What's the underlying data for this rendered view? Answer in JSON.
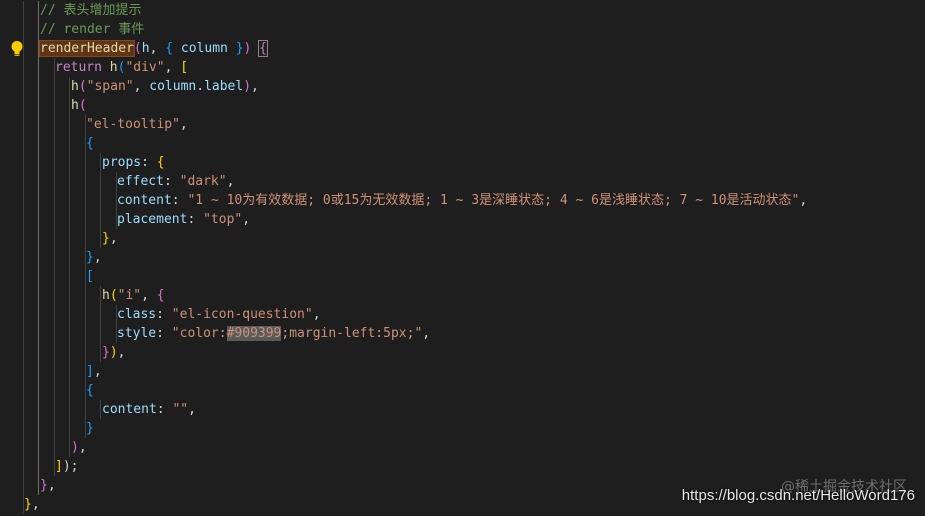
{
  "editor": {
    "lines": [
      {
        "indent": 2,
        "tokens": [
          {
            "t": "// 表头增加提示",
            "c": "c-comment"
          }
        ]
      },
      {
        "indent": 2,
        "tokens": [
          {
            "t": "// render 事件",
            "c": "c-comment"
          }
        ]
      },
      {
        "indent": 2,
        "tokens": [
          {
            "t": "renderHeader",
            "c": "c-func hl-word"
          },
          {
            "t": "(",
            "c": "c-b2"
          },
          {
            "t": "h",
            "c": "c-var"
          },
          {
            "t": ", ",
            "c": "c-punct"
          },
          {
            "t": "{",
            "c": "c-b3"
          },
          {
            "t": " ",
            "c": "c-punct"
          },
          {
            "t": "column",
            "c": "c-var"
          },
          {
            "t": " ",
            "c": "c-punct"
          },
          {
            "t": "}",
            "c": "c-b3"
          },
          {
            "t": ")",
            "c": "c-b2"
          },
          {
            "t": " ",
            "c": "c-punct"
          },
          {
            "t": "{",
            "c": "c-b2 bracket-match"
          }
        ]
      },
      {
        "indent": 3,
        "tokens": [
          {
            "t": "return",
            "c": "c-kw"
          },
          {
            "t": " ",
            "c": "c-punct"
          },
          {
            "t": "h",
            "c": "c-func"
          },
          {
            "t": "(",
            "c": "c-b3"
          },
          {
            "t": "\"div\"",
            "c": "c-str"
          },
          {
            "t": ", ",
            "c": "c-punct"
          },
          {
            "t": "[",
            "c": "c-b1"
          }
        ]
      },
      {
        "indent": 4,
        "tokens": [
          {
            "t": "h",
            "c": "c-func"
          },
          {
            "t": "(",
            "c": "c-b2"
          },
          {
            "t": "\"span\"",
            "c": "c-str"
          },
          {
            "t": ", ",
            "c": "c-punct"
          },
          {
            "t": "column",
            "c": "c-var"
          },
          {
            "t": ".",
            "c": "c-punct"
          },
          {
            "t": "label",
            "c": "c-var"
          },
          {
            "t": ")",
            "c": "c-b2"
          },
          {
            "t": ",",
            "c": "c-punct"
          }
        ]
      },
      {
        "indent": 4,
        "tokens": [
          {
            "t": "h",
            "c": "c-func"
          },
          {
            "t": "(",
            "c": "c-b2"
          }
        ]
      },
      {
        "indent": 5,
        "tokens": [
          {
            "t": "\"el-tooltip\"",
            "c": "c-str"
          },
          {
            "t": ",",
            "c": "c-punct"
          }
        ]
      },
      {
        "indent": 5,
        "tokens": [
          {
            "t": "{",
            "c": "c-b3"
          }
        ]
      },
      {
        "indent": 6,
        "tokens": [
          {
            "t": "props",
            "c": "c-prop"
          },
          {
            "t": ": ",
            "c": "c-punct"
          },
          {
            "t": "{",
            "c": "c-b1"
          }
        ]
      },
      {
        "indent": 7,
        "tokens": [
          {
            "t": "effect",
            "c": "c-prop"
          },
          {
            "t": ": ",
            "c": "c-punct"
          },
          {
            "t": "\"dark\"",
            "c": "c-str"
          },
          {
            "t": ",",
            "c": "c-punct"
          }
        ]
      },
      {
        "indent": 7,
        "tokens": [
          {
            "t": "content",
            "c": "c-prop"
          },
          {
            "t": ": ",
            "c": "c-punct"
          },
          {
            "t": "\"1 ~ 10为有效数据; 0或15为无效数据; 1 ~ 3是深睡状态; 4 ~ 6是浅睡状态; 7 ~ 10是活动状态\"",
            "c": "c-str"
          },
          {
            "t": ",",
            "c": "c-punct"
          }
        ]
      },
      {
        "indent": 7,
        "tokens": [
          {
            "t": "placement",
            "c": "c-prop"
          },
          {
            "t": ": ",
            "c": "c-punct"
          },
          {
            "t": "\"top\"",
            "c": "c-str"
          },
          {
            "t": ",",
            "c": "c-punct"
          }
        ]
      },
      {
        "indent": 6,
        "tokens": [
          {
            "t": "}",
            "c": "c-b1"
          },
          {
            "t": ",",
            "c": "c-punct"
          }
        ]
      },
      {
        "indent": 5,
        "tokens": [
          {
            "t": "}",
            "c": "c-b3"
          },
          {
            "t": ",",
            "c": "c-punct"
          }
        ]
      },
      {
        "indent": 5,
        "tokens": [
          {
            "t": "[",
            "c": "c-b3"
          }
        ]
      },
      {
        "indent": 6,
        "tokens": [
          {
            "t": "h",
            "c": "c-func"
          },
          {
            "t": "(",
            "c": "c-b1"
          },
          {
            "t": "\"i\"",
            "c": "c-str"
          },
          {
            "t": ", ",
            "c": "c-punct"
          },
          {
            "t": "{",
            "c": "c-b2"
          }
        ]
      },
      {
        "indent": 7,
        "tokens": [
          {
            "t": "class",
            "c": "c-prop"
          },
          {
            "t": ": ",
            "c": "c-punct"
          },
          {
            "t": "\"el-icon-question\"",
            "c": "c-str"
          },
          {
            "t": ",",
            "c": "c-punct"
          }
        ]
      },
      {
        "indent": 7,
        "tokens": [
          {
            "t": "style",
            "c": "c-prop"
          },
          {
            "t": ": ",
            "c": "c-punct"
          },
          {
            "t": "\"color:",
            "c": "c-str"
          },
          {
            "t": "#909399",
            "c": "c-str sel"
          },
          {
            "t": ";margin-left:5px;\"",
            "c": "c-str"
          },
          {
            "t": ",",
            "c": "c-punct"
          }
        ]
      },
      {
        "indent": 6,
        "tokens": [
          {
            "t": "}",
            "c": "c-b2"
          },
          {
            "t": ")",
            "c": "c-b1"
          },
          {
            "t": ",",
            "c": "c-punct"
          }
        ]
      },
      {
        "indent": 5,
        "tokens": [
          {
            "t": "]",
            "c": "c-b3"
          },
          {
            "t": ",",
            "c": "c-punct"
          }
        ]
      },
      {
        "indent": 5,
        "tokens": [
          {
            "t": "{",
            "c": "c-b3"
          }
        ]
      },
      {
        "indent": 6,
        "tokens": [
          {
            "t": "content",
            "c": "c-prop"
          },
          {
            "t": ": ",
            "c": "c-punct"
          },
          {
            "t": "\"\"",
            "c": "c-str"
          },
          {
            "t": ",",
            "c": "c-punct"
          }
        ]
      },
      {
        "indent": 5,
        "tokens": [
          {
            "t": "}",
            "c": "c-b3"
          }
        ]
      },
      {
        "indent": 4,
        "tokens": [
          {
            "t": ")",
            "c": "c-b2"
          },
          {
            "t": ",",
            "c": "c-punct"
          }
        ]
      },
      {
        "indent": 3,
        "tokens": [
          {
            "t": "]",
            "c": "c-b1"
          },
          {
            "t": ");",
            "c": "c-punct"
          }
        ]
      },
      {
        "indent": 2,
        "tokens": [
          {
            "t": "}",
            "c": "c-b2"
          },
          {
            "t": ",",
            "c": "c-punct"
          }
        ]
      },
      {
        "indent": 1,
        "tokens": [
          {
            "t": "}",
            "c": "c-b1"
          },
          {
            "t": ",",
            "c": "c-punct"
          }
        ]
      }
    ]
  },
  "gutter": {
    "lightbulb_icon": "lightbulb-icon",
    "lightbulb_color": "#ffcc00"
  },
  "watermark": {
    "text": "@稀土掘金技术社区",
    "url": "https://blog.csdn.net/HelloWord176"
  }
}
